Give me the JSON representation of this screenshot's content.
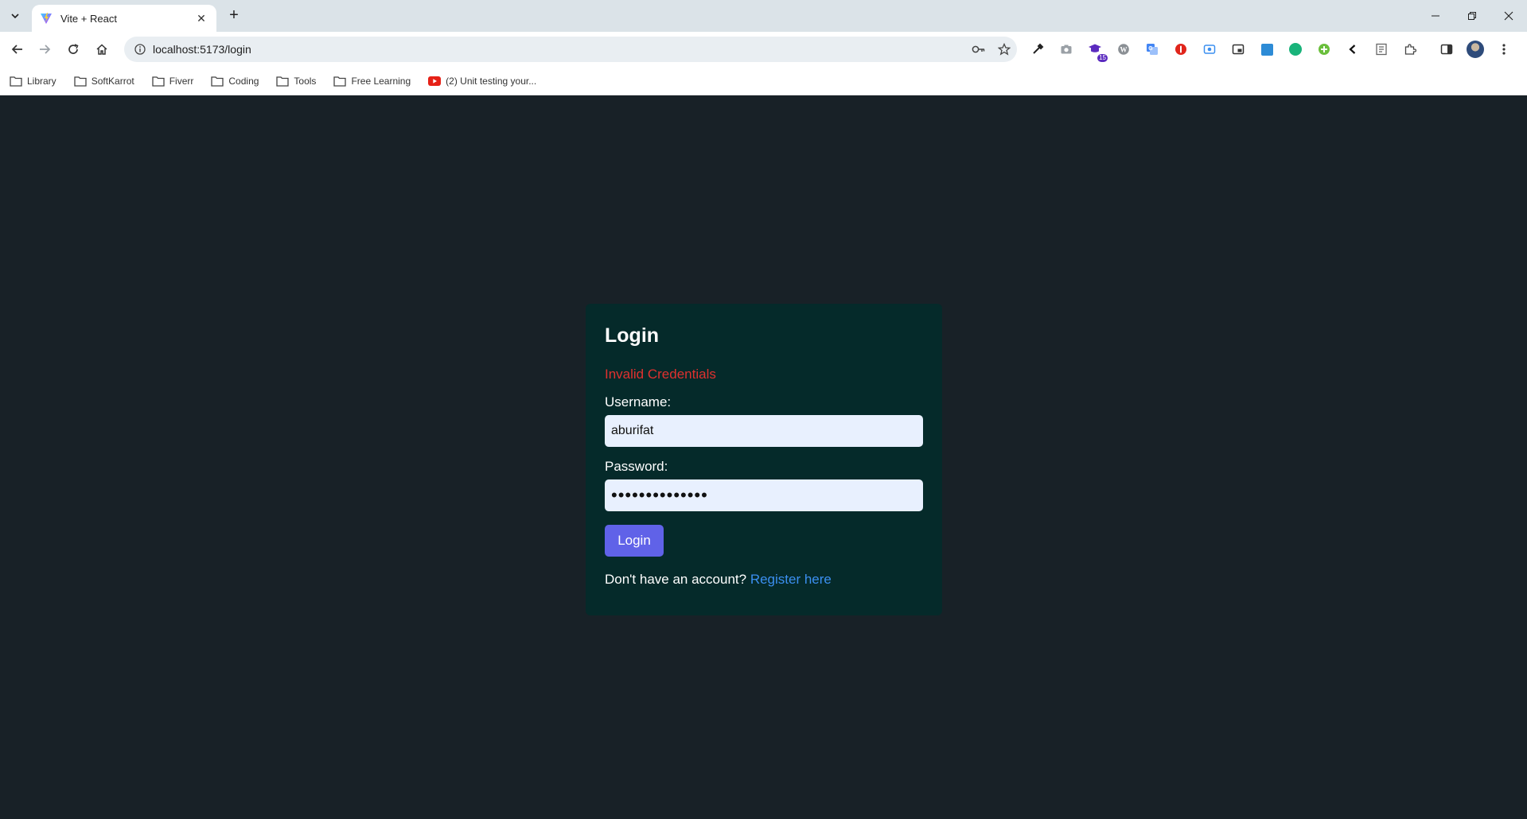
{
  "browser": {
    "tab": {
      "title": "Vite + React"
    },
    "address_bar": {
      "url": "localhost:5173/login"
    },
    "extension_badge": "15",
    "bookmarks": [
      {
        "label": "Library",
        "icon": "folder-icon"
      },
      {
        "label": "SoftKarrot",
        "icon": "folder-icon"
      },
      {
        "label": "Fiverr",
        "icon": "folder-icon"
      },
      {
        "label": "Coding",
        "icon": "folder-icon"
      },
      {
        "label": "Tools",
        "icon": "folder-icon"
      },
      {
        "label": "Free Learning",
        "icon": "folder-icon"
      },
      {
        "label": "(2) Unit testing your...",
        "icon": "youtube-icon"
      }
    ]
  },
  "login": {
    "title": "Login",
    "error": "Invalid Credentials",
    "username_label": "Username:",
    "username_value": "aburifat",
    "password_label": "Password:",
    "password_value": "••••••••••••••",
    "submit_label": "Login",
    "footer_text": "Don't have an account?",
    "register_link": "Register here"
  },
  "colors": {
    "page_background": "#182127",
    "card_background": "#052a2a",
    "error": "#e0312f",
    "button": "#6062e8",
    "link": "#3b8ff0",
    "input_background": "#e8f0fe"
  }
}
